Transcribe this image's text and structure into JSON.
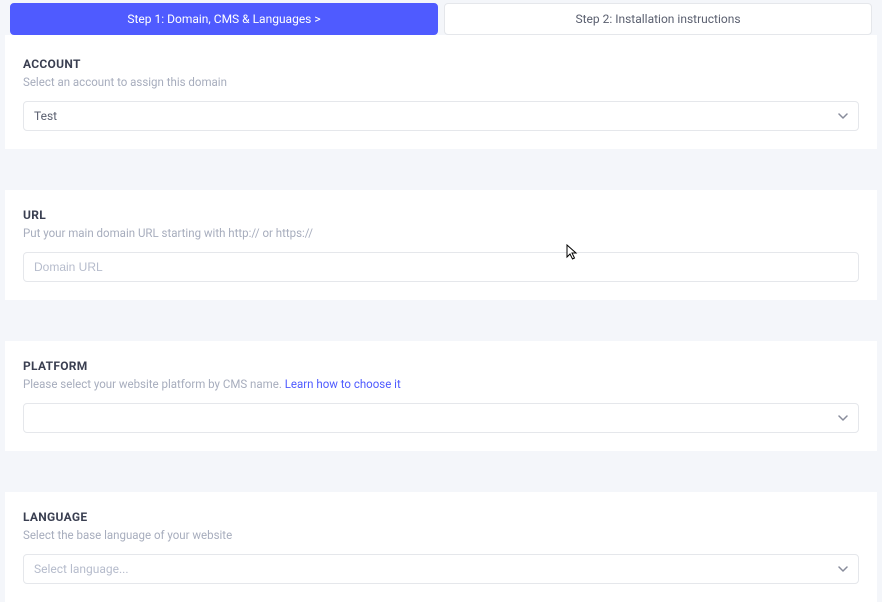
{
  "tabs": {
    "step1": "Step 1: Domain, CMS & Languages  >",
    "step2": "Step 2: Installation instructions"
  },
  "account": {
    "title": "ACCOUNT",
    "help": "Select an account to assign this domain",
    "value": "Test"
  },
  "url": {
    "title": "URL",
    "help": "Put your main domain URL starting with http:// or https://",
    "placeholder": "Domain URL"
  },
  "platform": {
    "title": "PLATFORM",
    "help_prefix": "Please select your website platform by CMS name.  ",
    "help_link": "Learn how to choose it",
    "value": ""
  },
  "language": {
    "title": "LANGUAGE",
    "help": "Select the base language of your website",
    "placeholder": "Select language..."
  }
}
